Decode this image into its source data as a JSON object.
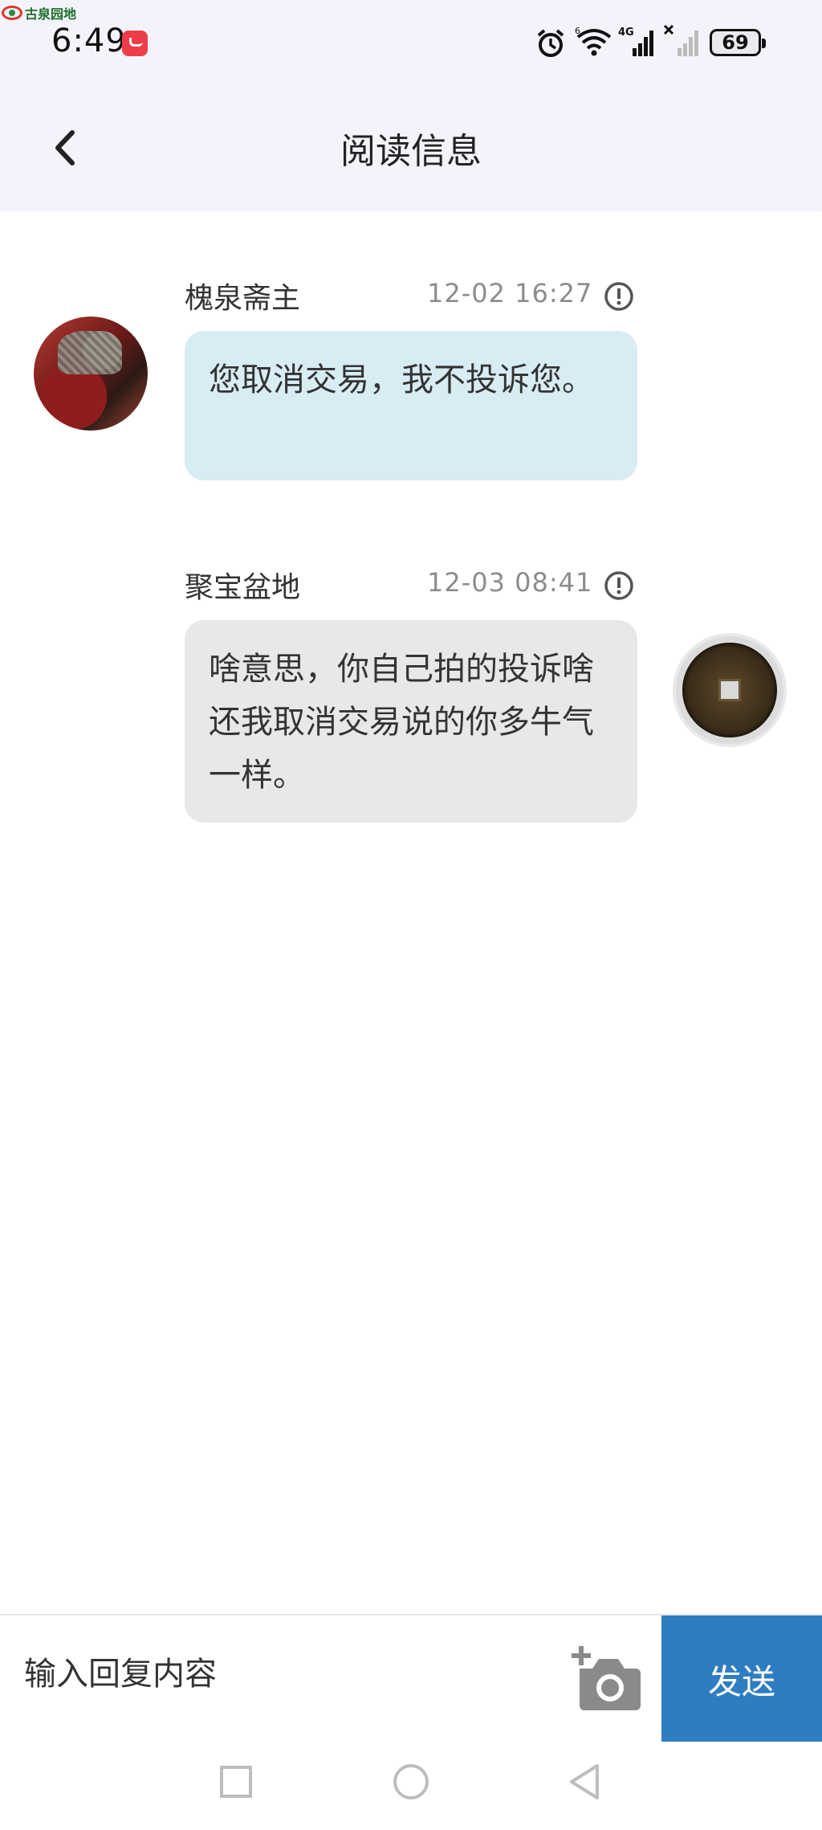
{
  "status_bar": {
    "watermark_text": "古泉园地",
    "time": "6:49",
    "battery": "69",
    "network_label": "4G"
  },
  "header": {
    "title": "阅读信息"
  },
  "messages": [
    {
      "sender": "槐泉斋主",
      "time": "12-02 16:27",
      "text": "您取消交易，我不投诉您。",
      "side": "left"
    },
    {
      "sender": "聚宝盆地",
      "time": "12-03 08:41",
      "text": "啥意思，你自己拍的投诉啥还我取消交易说的你多牛气一样。",
      "side": "right"
    }
  ],
  "reply": {
    "placeholder": "输入回复内容",
    "send_label": "发送"
  },
  "colors": {
    "header_bg": "#f3f4fb",
    "received_bubble": "#d8ecf4",
    "sent_bubble": "#e8e8e8",
    "send_button": "#2f7dc1"
  },
  "icons": {
    "back": "chevron-left-icon",
    "alert": "exclamation-circle-icon",
    "camera": "camera-add-icon"
  }
}
